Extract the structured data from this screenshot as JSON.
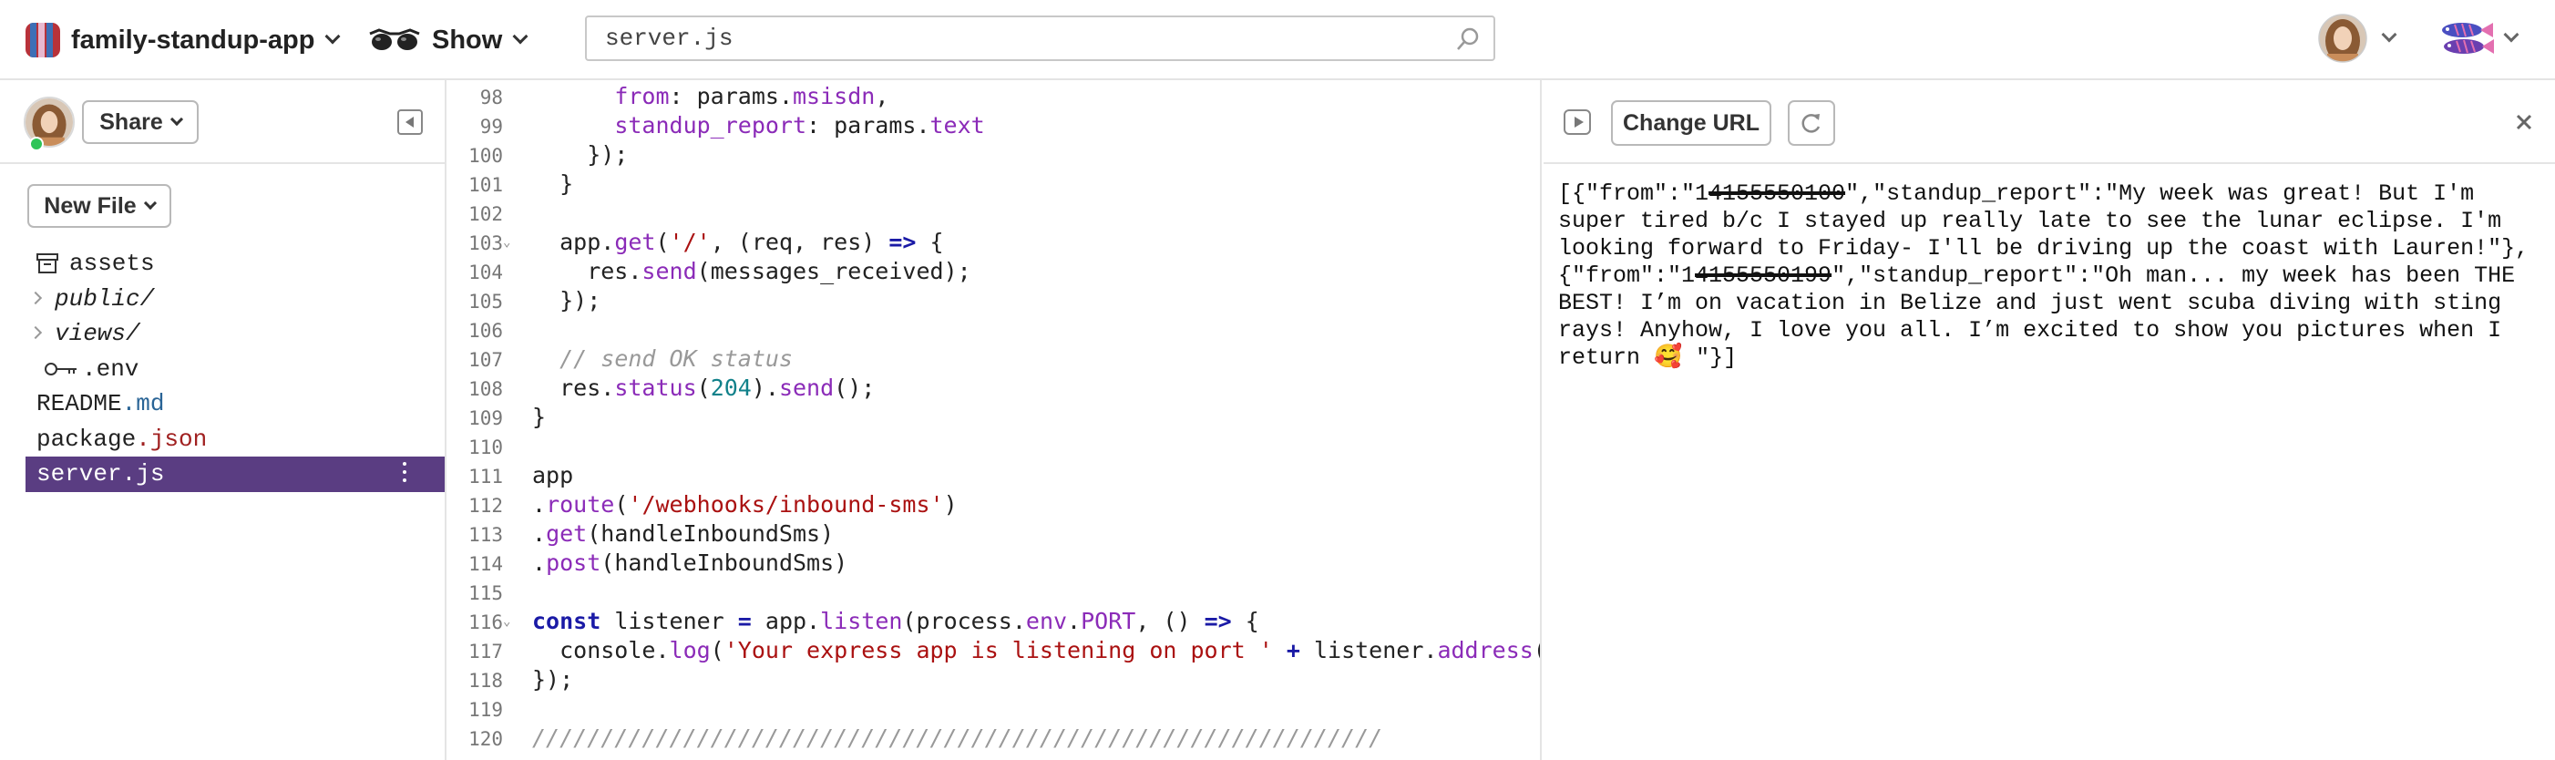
{
  "header": {
    "project_name": "family-standup-app",
    "show_label": "Show",
    "search_value": "server.js",
    "search_placeholder": "server.js"
  },
  "sidebar": {
    "share_label": "Share",
    "new_file_label": "New File",
    "files": [
      {
        "name": "assets",
        "type": "assets"
      },
      {
        "name": "public/",
        "type": "folder"
      },
      {
        "name": "views/",
        "type": "folder"
      },
      {
        "name": ".env",
        "type": "env"
      },
      {
        "name_base": "README",
        "name_ext": ".md",
        "type": "file"
      },
      {
        "name_base": "package",
        "name_ext": ".json",
        "type": "file"
      },
      {
        "name": "server.js",
        "type": "active"
      }
    ]
  },
  "editor": {
    "lines": [
      {
        "num": "98",
        "fold": false,
        "html": "      <span class=\"p\">from</span>: params.<span class=\"p\">msisdn</span>,"
      },
      {
        "num": "99",
        "fold": false,
        "html": "      <span class=\"p\">standup_report</span>: params.<span class=\"p\">text</span>"
      },
      {
        "num": "100",
        "fold": false,
        "html": "    });"
      },
      {
        "num": "101",
        "fold": false,
        "html": "  }"
      },
      {
        "num": "102",
        "fold": false,
        "html": ""
      },
      {
        "num": "103",
        "fold": true,
        "html": "  app.<span class=\"p\">get</span>(<span class=\"s\">'/'</span>, (req, res) <span class=\"k\">=></span> {"
      },
      {
        "num": "104",
        "fold": false,
        "html": "    res.<span class=\"p\">send</span>(messages_received);"
      },
      {
        "num": "105",
        "fold": false,
        "html": "  });"
      },
      {
        "num": "106",
        "fold": false,
        "html": ""
      },
      {
        "num": "107",
        "fold": false,
        "html": "  <span class=\"c\">// send OK status</span>"
      },
      {
        "num": "108",
        "fold": false,
        "html": "  res.<span class=\"p\">status</span>(<span class=\"n\">204</span>).<span class=\"p\">send</span>();"
      },
      {
        "num": "109",
        "fold": false,
        "html": "}"
      },
      {
        "num": "110",
        "fold": false,
        "html": ""
      },
      {
        "num": "111",
        "fold": false,
        "html": "app"
      },
      {
        "num": "112",
        "fold": false,
        "html": ".<span class=\"p\">route</span>(<span class=\"s\">'/webhooks/inbound-sms'</span>)"
      },
      {
        "num": "113",
        "fold": false,
        "html": ".<span class=\"p\">get</span>(handleInboundSms)"
      },
      {
        "num": "114",
        "fold": false,
        "html": ".<span class=\"p\">post</span>(handleInboundSms)"
      },
      {
        "num": "115",
        "fold": false,
        "html": ""
      },
      {
        "num": "116",
        "fold": true,
        "html": "<span class=\"k\">const</span> listener <span class=\"k\">=</span> app.<span class=\"p\">listen</span>(process.<span class=\"p\">env</span>.<span class=\"p\">PORT</span>, () <span class=\"k\">=></span> {"
      },
      {
        "num": "117",
        "fold": false,
        "html": "  console.<span class=\"p\">log</span>(<span class=\"s\">'Your express app is listening on port '</span> <span class=\"k\">+</span> listener.<span class=\"p\">address</span>().port);"
      },
      {
        "num": "118",
        "fold": false,
        "html": "});"
      },
      {
        "num": "119",
        "fold": false,
        "html": ""
      },
      {
        "num": "120",
        "fold": false,
        "html": "<span class=\"c\">//////////////////////////////////////////////////////////////</span>"
      }
    ]
  },
  "preview": {
    "change_url_label": "Change URL",
    "segments": [
      {
        "text": "[{\"from\":\"1",
        "redacted": false
      },
      {
        "text": "4155550100",
        "redacted": true
      },
      {
        "text": "\",\"standup_report\":\"My week was great! But I'm super tired b/c I stayed up really late to see the lunar eclipse. I'm looking forward to Friday- I'll be driving up the coast with Lauren!\"},{\"from\":\"1",
        "redacted": false
      },
      {
        "text": "4155550199",
        "redacted": true
      },
      {
        "text": "\",\"standup_report\":\"Oh man... my week has been THE BEST! I’m on vacation in Belize and just went scuba diving with sting rays! Anyhow, I love you all. I’m excited to show you pictures when I return 🥰 \"}]",
        "redacted": false
      }
    ]
  },
  "colors": {
    "active_file_bg": "#5a3d82",
    "keyword": "#1a1aa6",
    "property": "#8b2bb8",
    "string": "#a11",
    "number": "#11818a",
    "online": "#2ec458"
  },
  "icons": [
    "project-logo-icon",
    "glasses-icon",
    "search-icon",
    "chevron-down-icon",
    "collapse-sidebar-icon",
    "assets-box-icon",
    "key-icon",
    "kebab-menu-icon",
    "play-icon",
    "refresh-icon",
    "close-icon",
    "fish-logo-icon"
  ]
}
